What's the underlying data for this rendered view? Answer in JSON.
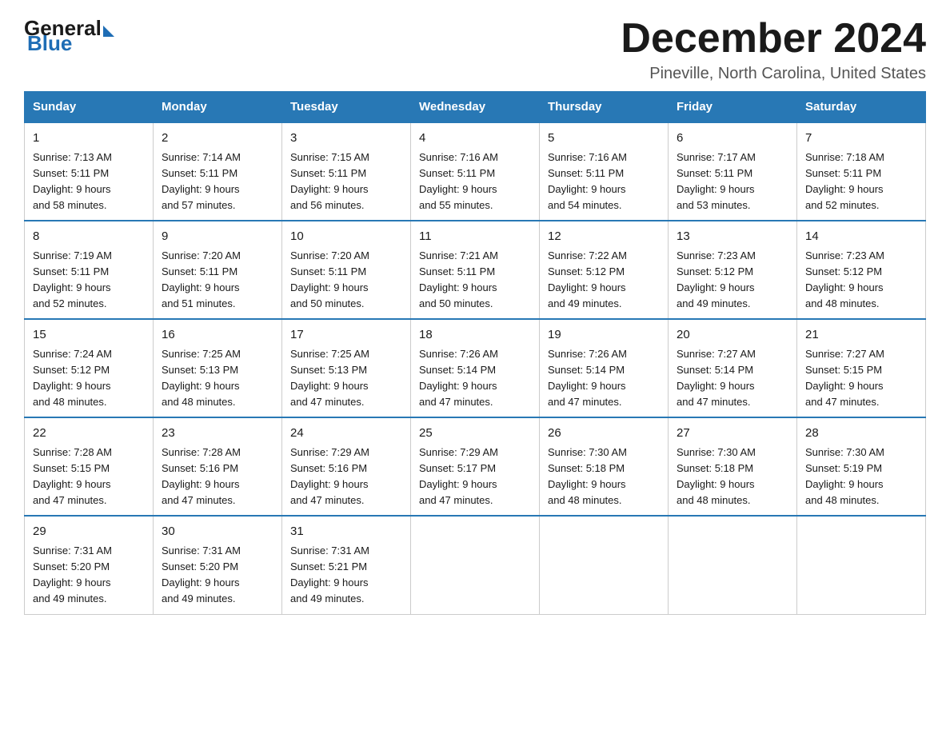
{
  "header": {
    "logo_general": "General",
    "logo_blue": "Blue",
    "month_title": "December 2024",
    "subtitle": "Pineville, North Carolina, United States"
  },
  "days_of_week": [
    "Sunday",
    "Monday",
    "Tuesday",
    "Wednesday",
    "Thursday",
    "Friday",
    "Saturday"
  ],
  "weeks": [
    [
      {
        "day": "1",
        "sunrise": "7:13 AM",
        "sunset": "5:11 PM",
        "daylight": "9 hours and 58 minutes."
      },
      {
        "day": "2",
        "sunrise": "7:14 AM",
        "sunset": "5:11 PM",
        "daylight": "9 hours and 57 minutes."
      },
      {
        "day": "3",
        "sunrise": "7:15 AM",
        "sunset": "5:11 PM",
        "daylight": "9 hours and 56 minutes."
      },
      {
        "day": "4",
        "sunrise": "7:16 AM",
        "sunset": "5:11 PM",
        "daylight": "9 hours and 55 minutes."
      },
      {
        "day": "5",
        "sunrise": "7:16 AM",
        "sunset": "5:11 PM",
        "daylight": "9 hours and 54 minutes."
      },
      {
        "day": "6",
        "sunrise": "7:17 AM",
        "sunset": "5:11 PM",
        "daylight": "9 hours and 53 minutes."
      },
      {
        "day": "7",
        "sunrise": "7:18 AM",
        "sunset": "5:11 PM",
        "daylight": "9 hours and 52 minutes."
      }
    ],
    [
      {
        "day": "8",
        "sunrise": "7:19 AM",
        "sunset": "5:11 PM",
        "daylight": "9 hours and 52 minutes."
      },
      {
        "day": "9",
        "sunrise": "7:20 AM",
        "sunset": "5:11 PM",
        "daylight": "9 hours and 51 minutes."
      },
      {
        "day": "10",
        "sunrise": "7:20 AM",
        "sunset": "5:11 PM",
        "daylight": "9 hours and 50 minutes."
      },
      {
        "day": "11",
        "sunrise": "7:21 AM",
        "sunset": "5:11 PM",
        "daylight": "9 hours and 50 minutes."
      },
      {
        "day": "12",
        "sunrise": "7:22 AM",
        "sunset": "5:12 PM",
        "daylight": "9 hours and 49 minutes."
      },
      {
        "day": "13",
        "sunrise": "7:23 AM",
        "sunset": "5:12 PM",
        "daylight": "9 hours and 49 minutes."
      },
      {
        "day": "14",
        "sunrise": "7:23 AM",
        "sunset": "5:12 PM",
        "daylight": "9 hours and 48 minutes."
      }
    ],
    [
      {
        "day": "15",
        "sunrise": "7:24 AM",
        "sunset": "5:12 PM",
        "daylight": "9 hours and 48 minutes."
      },
      {
        "day": "16",
        "sunrise": "7:25 AM",
        "sunset": "5:13 PM",
        "daylight": "9 hours and 48 minutes."
      },
      {
        "day": "17",
        "sunrise": "7:25 AM",
        "sunset": "5:13 PM",
        "daylight": "9 hours and 47 minutes."
      },
      {
        "day": "18",
        "sunrise": "7:26 AM",
        "sunset": "5:14 PM",
        "daylight": "9 hours and 47 minutes."
      },
      {
        "day": "19",
        "sunrise": "7:26 AM",
        "sunset": "5:14 PM",
        "daylight": "9 hours and 47 minutes."
      },
      {
        "day": "20",
        "sunrise": "7:27 AM",
        "sunset": "5:14 PM",
        "daylight": "9 hours and 47 minutes."
      },
      {
        "day": "21",
        "sunrise": "7:27 AM",
        "sunset": "5:15 PM",
        "daylight": "9 hours and 47 minutes."
      }
    ],
    [
      {
        "day": "22",
        "sunrise": "7:28 AM",
        "sunset": "5:15 PM",
        "daylight": "9 hours and 47 minutes."
      },
      {
        "day": "23",
        "sunrise": "7:28 AM",
        "sunset": "5:16 PM",
        "daylight": "9 hours and 47 minutes."
      },
      {
        "day": "24",
        "sunrise": "7:29 AM",
        "sunset": "5:16 PM",
        "daylight": "9 hours and 47 minutes."
      },
      {
        "day": "25",
        "sunrise": "7:29 AM",
        "sunset": "5:17 PM",
        "daylight": "9 hours and 47 minutes."
      },
      {
        "day": "26",
        "sunrise": "7:30 AM",
        "sunset": "5:18 PM",
        "daylight": "9 hours and 48 minutes."
      },
      {
        "day": "27",
        "sunrise": "7:30 AM",
        "sunset": "5:18 PM",
        "daylight": "9 hours and 48 minutes."
      },
      {
        "day": "28",
        "sunrise": "7:30 AM",
        "sunset": "5:19 PM",
        "daylight": "9 hours and 48 minutes."
      }
    ],
    [
      {
        "day": "29",
        "sunrise": "7:31 AM",
        "sunset": "5:20 PM",
        "daylight": "9 hours and 49 minutes."
      },
      {
        "day": "30",
        "sunrise": "7:31 AM",
        "sunset": "5:20 PM",
        "daylight": "9 hours and 49 minutes."
      },
      {
        "day": "31",
        "sunrise": "7:31 AM",
        "sunset": "5:21 PM",
        "daylight": "9 hours and 49 minutes."
      },
      null,
      null,
      null,
      null
    ]
  ],
  "labels": {
    "sunrise": "Sunrise: ",
    "sunset": "Sunset: ",
    "daylight": "Daylight: "
  }
}
